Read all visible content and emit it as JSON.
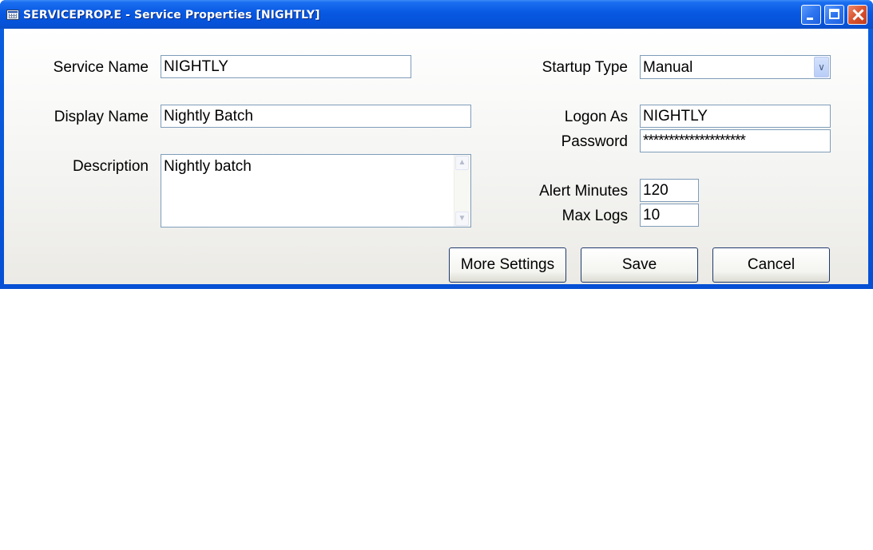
{
  "window": {
    "title": "SERVICEPROP.E - Service Properties [NIGHTLY]",
    "icon": "app-grid-icon",
    "controls": [
      "minimize-icon",
      "maximize-icon",
      "close-icon"
    ]
  },
  "form": {
    "service_name": {
      "label": "Service Name",
      "value": "NIGHTLY"
    },
    "display_name": {
      "label": "Display Name",
      "value": "Nightly Batch"
    },
    "description": {
      "label": "Description",
      "value": "Nightly batch"
    },
    "startup_type": {
      "label": "Startup Type",
      "value": "Manual"
    },
    "logon_as": {
      "label": "Logon As",
      "value": "NIGHTLY"
    },
    "password": {
      "label": "Password",
      "value": "********************"
    },
    "alert_minutes": {
      "label": "Alert Minutes",
      "value": "120"
    },
    "max_logs": {
      "label": "Max Logs",
      "value": "10"
    }
  },
  "buttons": {
    "more_settings": "More Settings",
    "save": "Save",
    "cancel": "Cancel"
  },
  "colors": {
    "titlebar": "#0652d8",
    "field_border": "#7f9db9",
    "button_border": "#1f3a6e"
  }
}
